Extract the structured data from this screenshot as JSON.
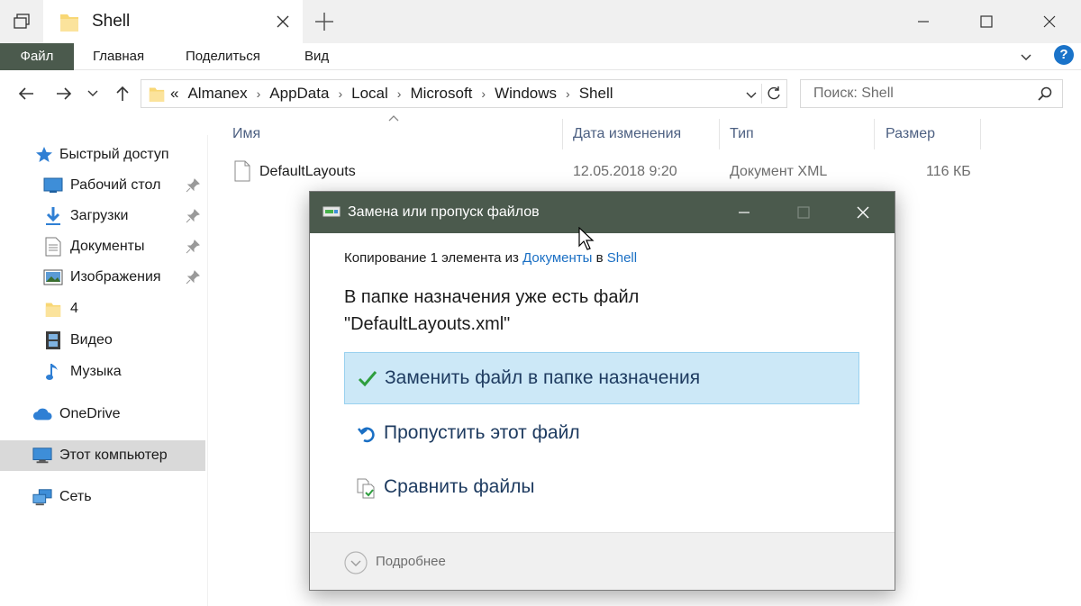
{
  "window": {
    "tab_title": "Shell"
  },
  "ribbon": {
    "tabs": [
      "Файл",
      "Главная",
      "Поделиться",
      "Вид"
    ],
    "help_label": "?"
  },
  "address": {
    "overflow": "«",
    "crumbs": [
      "Almanex",
      "AppData",
      "Local",
      "Microsoft",
      "Windows",
      "Shell"
    ],
    "search_placeholder": "Поиск: Shell"
  },
  "sidebar": {
    "items": [
      {
        "label": "Быстрый доступ",
        "icon": "star-icon"
      },
      {
        "label": "Рабочий стол",
        "icon": "desktop-icon",
        "pinned": true
      },
      {
        "label": "Загрузки",
        "icon": "download-icon",
        "pinned": true
      },
      {
        "label": "Документы",
        "icon": "document-icon",
        "pinned": true
      },
      {
        "label": "Изображения",
        "icon": "pictures-icon",
        "pinned": true
      },
      {
        "label": "4",
        "icon": "folder-icon"
      },
      {
        "label": "Видео",
        "icon": "video-icon"
      },
      {
        "label": "Музыка",
        "icon": "music-icon"
      },
      {
        "label": "OneDrive",
        "icon": "cloud-icon"
      },
      {
        "label": "Этот компьютер",
        "icon": "computer-icon",
        "selected": true
      },
      {
        "label": "Сеть",
        "icon": "network-icon"
      }
    ]
  },
  "file_list": {
    "columns": [
      "Имя",
      "Дата изменения",
      "Тип",
      "Размер"
    ],
    "rows": [
      {
        "name": "DefaultLayouts",
        "date": "12.05.2018 9:20",
        "type": "Документ XML",
        "size": "116 КБ"
      }
    ]
  },
  "dialog": {
    "title": "Замена или пропуск файлов",
    "subtitle_prefix": "Копирование 1 элемента из ",
    "subtitle_source": "Документы",
    "subtitle_middle": " в ",
    "subtitle_dest": "Shell",
    "message_line1": "В папке назначения уже есть файл",
    "message_line2": "\"DefaultLayouts.xml\"",
    "options": [
      {
        "label": "Заменить файл в папке назначения",
        "icon": "checkmark-icon"
      },
      {
        "label": "Пропустить этот файл",
        "icon": "skip-icon"
      },
      {
        "label": "Сравнить файлы",
        "icon": "compare-icon"
      }
    ],
    "more_details": "Подробнее"
  },
  "colors": {
    "accent": "#4b5a4d",
    "link": "#1a6fc4",
    "highlight": "#cce8f7",
    "column_header": "#4d6082"
  }
}
